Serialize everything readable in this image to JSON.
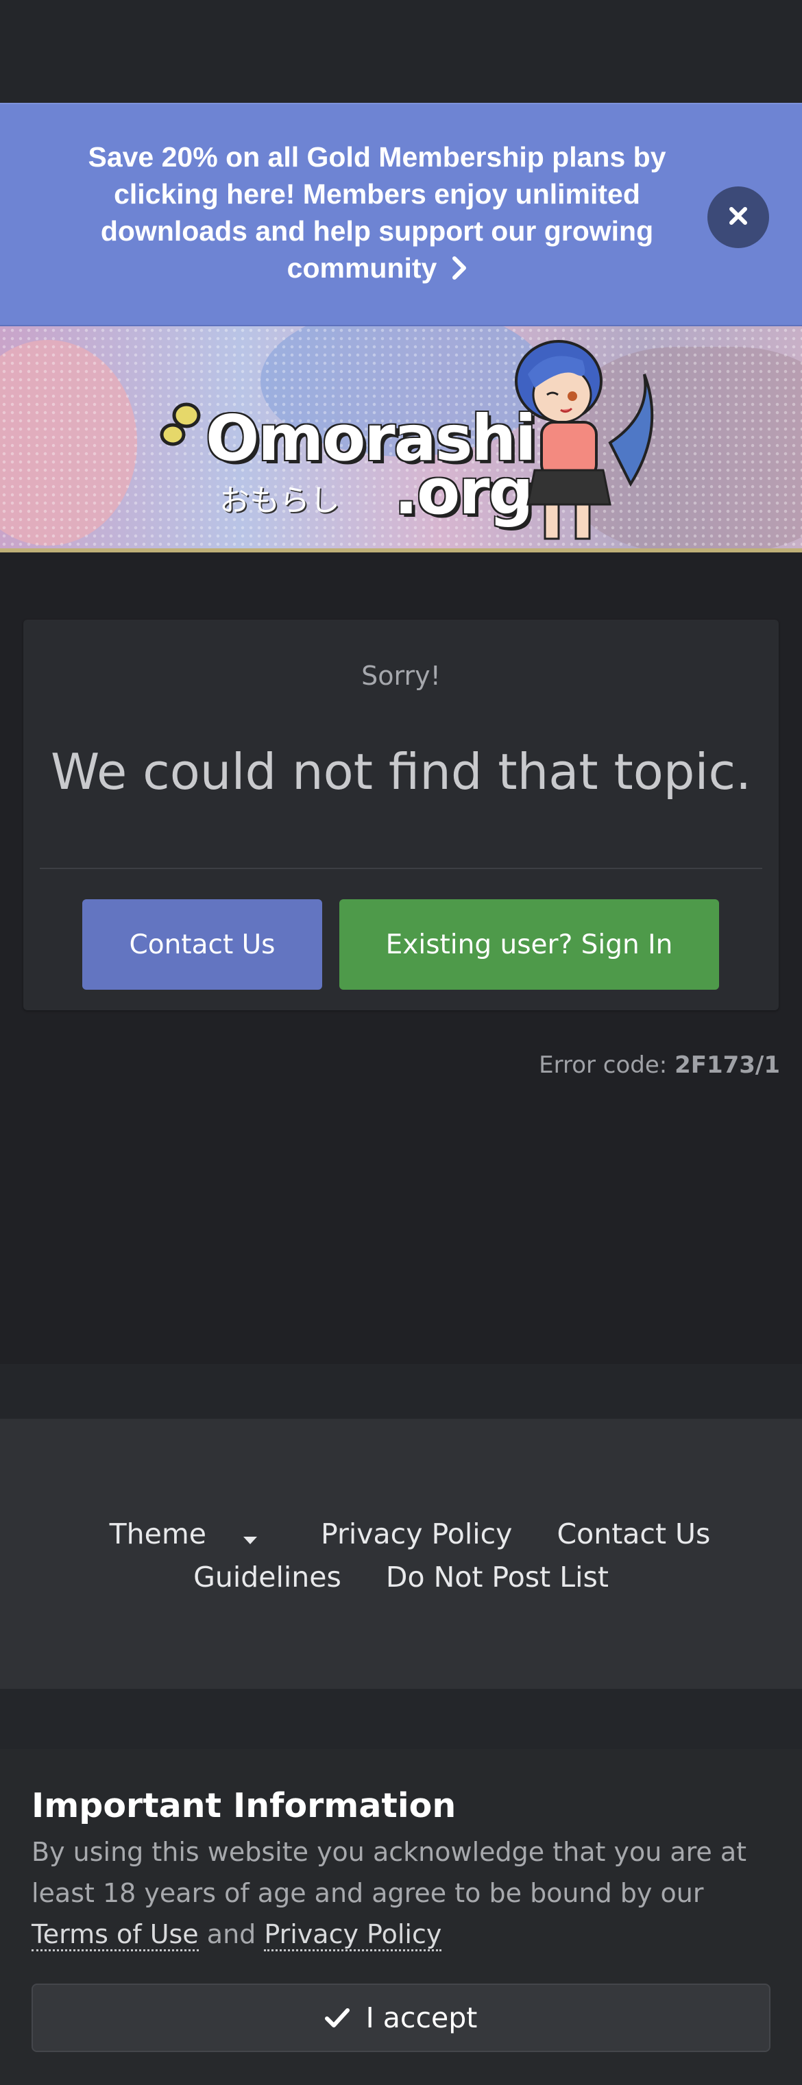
{
  "promo": {
    "text": "Save 20% on all Gold Membership plans by clicking here! Members enjoy unlimited downloads and help support our growing community",
    "close_icon": "close-icon",
    "bg_color": "#6e84d3"
  },
  "header": {
    "logo_text": "Omorashi",
    "logo_suffix": ".org",
    "logo_japanese": "おもらし"
  },
  "error": {
    "subtitle": "Sorry!",
    "title": "We could not find that topic.",
    "contact_label": "Contact Us",
    "signin_label": "Existing user? Sign In",
    "code_label": "Error code:",
    "code_value": "2F173/1",
    "contact_color": "#6375c1",
    "signin_color": "#4e9a4a"
  },
  "footer": {
    "theme_label": "Theme",
    "privacy_label": "Privacy Policy",
    "contact_label": "Contact Us",
    "guidelines_label": "Guidelines",
    "dnp_label": "Do Not Post List"
  },
  "notice": {
    "title": "Important Information",
    "body_prefix": "By using this website you acknowledge that you are at least 18 years of age and agree to be bound by our",
    "terms_label": "Terms of Use",
    "and": "and",
    "privacy_label": "Privacy Policy",
    "accept_label": "I accept"
  }
}
